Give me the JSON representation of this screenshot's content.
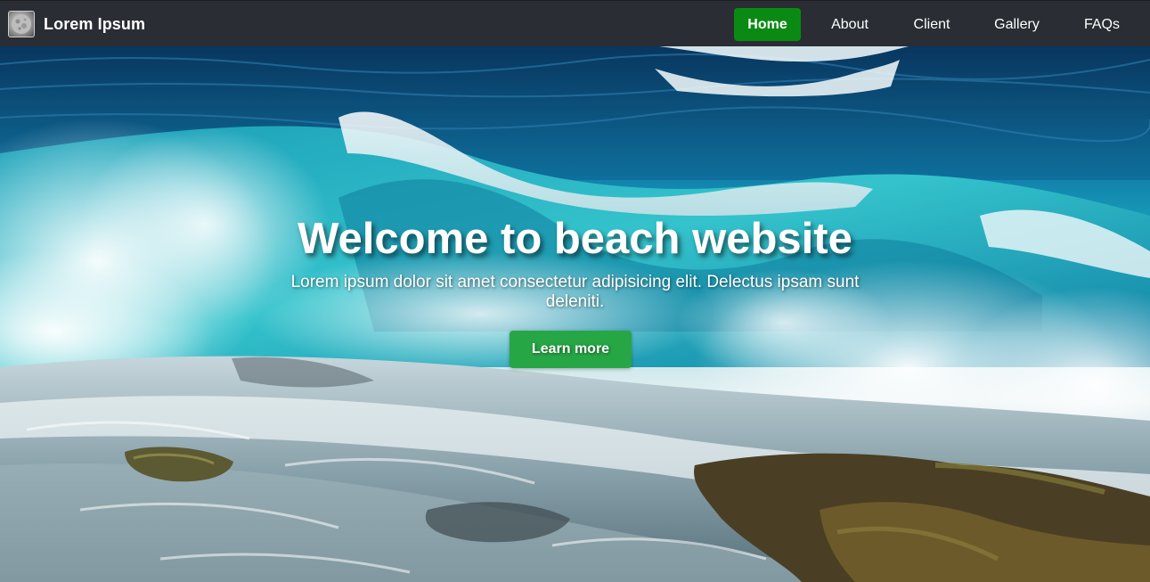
{
  "navbar": {
    "brand_name": "Lorem Ipsum",
    "brand_logo_icon": "moon-logo-icon",
    "links": [
      {
        "label": "Home",
        "active": true
      },
      {
        "label": "About",
        "active": false
      },
      {
        "label": "Client",
        "active": false
      },
      {
        "label": "Gallery",
        "active": false
      },
      {
        "label": "FAQs",
        "active": false
      }
    ]
  },
  "hero": {
    "background_image": "ocean-waves-on-rocks",
    "title": "Welcome to beach website",
    "text": "Lorem ipsum dolor sit amet consectetur adipisicing elit. Delectus ipsam sunt deleniti.",
    "button_label": "Learn more"
  },
  "colors": {
    "navbar_bg": "#2a2d34",
    "active_link_bg": "#0a8a13",
    "button_bg": "#27a645",
    "text": "#ffffff"
  }
}
